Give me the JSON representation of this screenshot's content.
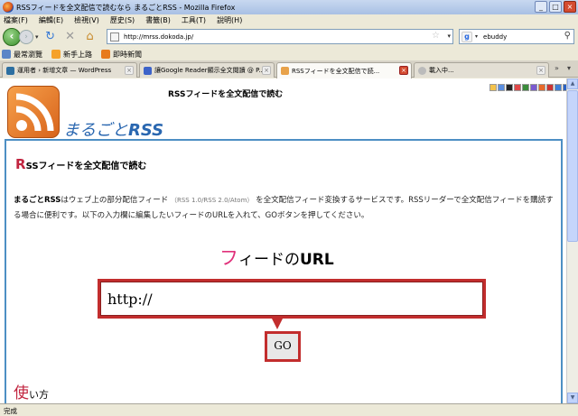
{
  "window": {
    "title": "RSSフィードを全文配信で読むなら まるごとRSS - Mozilla Firefox",
    "controls": [
      "_",
      "□",
      "×"
    ]
  },
  "menu": [
    "檔案(F)",
    "編輯(E)",
    "檢視(V)",
    "歷史(S)",
    "書籤(B)",
    "工具(T)",
    "說明(H)"
  ],
  "nav": {
    "url": "http://mrss.dokoda.jp/",
    "search_value": "ebuddy",
    "search_engine_letter": "g"
  },
  "bookmarks": [
    {
      "label": "最常瀏覽",
      "color": "#5b86c7"
    },
    {
      "label": "新手上路",
      "color": "#f5a12a"
    },
    {
      "label": "即時新聞",
      "color": "#e77a1c"
    }
  ],
  "tabs": [
    {
      "label": "運用者 › 新增文章 — WordPress",
      "color": "#2d6fa1",
      "active": false
    },
    {
      "label": "讓Google Reader顯示全文閱讀 @ P...",
      "color": "#3d63c9",
      "active": false
    },
    {
      "label": "RSSフィードを全文配信で読...",
      "color": "#e8a24a",
      "active": true
    },
    {
      "label": "載入中...",
      "color": "#bbbbbb",
      "active": false
    }
  ],
  "page": {
    "header_title": "RSSフィードを全文配信で読む",
    "site_name_prefix": "まるごと",
    "site_name_suffix": "RSS",
    "section_initial": "R",
    "section_title_rest": "SSフィードを全文配信で読む",
    "desc_bold": "まるごとRSS",
    "desc_part1": "はウェブ上の部分配信フィード",
    "desc_small": "（RSS 1.0/RSS 2.0/Atom）",
    "desc_part2": "を全文配信フィード変換するサービスです。RSSリーダーで全文配信フィードを購読する場合に便利です。以下の入力欄に編集したいフィードのURLを入れて、GOボタンを押してください。",
    "feed_initial": "フ",
    "feed_mid": "ィードの",
    "feed_bold": "URL",
    "url_input_value": "http://",
    "go_label": "GO",
    "usage_initial": "使",
    "usage_rest": "い方"
  },
  "status": "完成"
}
